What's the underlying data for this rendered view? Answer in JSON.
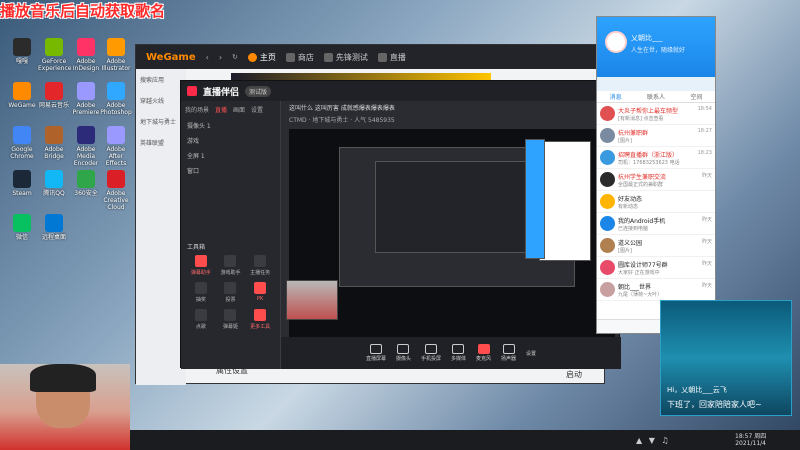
{
  "overlay": {
    "title": "播放音乐后自动获取歌名"
  },
  "desktop": {
    "icons": [
      {
        "label": "嘎嘎",
        "color": "#2b2b2b"
      },
      {
        "label": "GeForce Experience",
        "color": "#76b900"
      },
      {
        "label": "Adobe InDesign",
        "color": "#ff3366"
      },
      {
        "label": "Adobe Illustrator",
        "color": "#ff9a00"
      },
      {
        "label": "WeGame",
        "color": "#ff8a00"
      },
      {
        "label": "网易云音乐",
        "color": "#e3262a"
      },
      {
        "label": "Adobe Premiere",
        "color": "#9999ff"
      },
      {
        "label": "Adobe Photoshop",
        "color": "#31a8ff"
      },
      {
        "label": "Google Chrome",
        "color": "#4285f4"
      },
      {
        "label": "Adobe Bridge",
        "color": "#b0622b"
      },
      {
        "label": "Adobe Media Encoder",
        "color": "#2b2b7a"
      },
      {
        "label": "Adobe After Effects",
        "color": "#9999ff"
      },
      {
        "label": "Steam",
        "color": "#1b2838"
      },
      {
        "label": "腾讯QQ",
        "color": "#12b7f5"
      },
      {
        "label": "360安全",
        "color": "#2fa64a"
      },
      {
        "label": "Adobe Creative Cloud",
        "color": "#da1f26"
      },
      {
        "label": "微信",
        "color": "#07c160"
      },
      {
        "label": "远程桌面",
        "color": "#0078d4"
      }
    ]
  },
  "wegame": {
    "logo": "WeGame",
    "tabs": [
      "主页",
      "商店",
      "先锋测试",
      "直播"
    ],
    "side_items": [
      "搜索应用",
      "穿越火线",
      "地下城与勇士",
      "英雄联盟"
    ],
    "bottom_left": "属性设置",
    "bottom_right": "启动"
  },
  "live": {
    "logo": "直播伴侣",
    "version": "测试版",
    "left_tabs": [
      "我的场景",
      "直播",
      "画面",
      "设置"
    ],
    "scenes": [
      "摄像头 1",
      "游戏",
      "全屏 1",
      "窗口"
    ],
    "tools_title": "工具箱",
    "tools": [
      {
        "label": "弹幕助手",
        "red": true
      },
      {
        "label": "游戏助手",
        "red": false
      },
      {
        "label": "主播任务",
        "red": false
      },
      {
        "label": "抽奖",
        "red": false
      },
      {
        "label": "投票",
        "red": false
      },
      {
        "label": "PK",
        "red": true
      },
      {
        "label": "点歌",
        "red": false
      },
      {
        "label": "弹幕姬",
        "red": false
      },
      {
        "label": "更多工具",
        "red": true
      }
    ],
    "status_line": "这叫什么 这叫厉害 成就感爆表爆表爆表",
    "sub_line": "CTMD · 地下城与勇士  ·  人气 5485935",
    "bottom_bar": [
      {
        "label": "直播屏幕",
        "red": false
      },
      {
        "label": "摄像头",
        "red": false
      },
      {
        "label": "手机投屏",
        "red": false
      },
      {
        "label": "多媒体",
        "red": false
      },
      {
        "label": "麦克风",
        "red": true
      },
      {
        "label": "扬声器",
        "red": false
      }
    ],
    "settings_label": "设置"
  },
  "qq": {
    "name": "乂朝比___",
    "signature": "人生在世，随缘就好",
    "tabs": [
      "消息",
      "联系人",
      "空间"
    ],
    "items": [
      {
        "name": "大炎子帮你上最车频型",
        "msg": "[有新消息] 点击查看",
        "time": "18:54",
        "color": "#e05050",
        "red": true
      },
      {
        "name": "杭州兼职群",
        "msg": "[图片]",
        "time": "18:27",
        "color": "#7a8aa0",
        "red": true
      },
      {
        "name": "招聘直播群（浙江版）",
        "msg": "司机：17683253623 电话",
        "time": "18:23",
        "color": "#3a9ae0",
        "red": true
      },
      {
        "name": "杭州学生兼职交流",
        "msg": "全国最正式的兼职群",
        "time": "昨天",
        "color": "#2b2b2b",
        "red": true
      },
      {
        "name": "好友动态",
        "msg": "有新动态",
        "time": "",
        "color": "#ffb400",
        "red": false
      },
      {
        "name": "我的Android手机",
        "msg": "已连接到电脑",
        "time": "昨天",
        "color": "#1a86e8",
        "red": false
      },
      {
        "name": "道义公园",
        "msg": "[图片]",
        "time": "昨天",
        "color": "#b08050",
        "red": false
      },
      {
        "name": "圆库设计师77号群",
        "msg": "大家好 正在游戏中",
        "time": "昨天",
        "color": "#e84a6a",
        "red": false
      },
      {
        "name": "朝比___世界",
        "msg": "九尾（薄荷~大叶）",
        "time": "昨天",
        "color": "#c8a0a0",
        "red": false
      }
    ]
  },
  "notification": {
    "greeting": "Hi，乂朝比___云飞",
    "message": "下班了，回家陪陪家人吧~"
  },
  "taskbar": {
    "time": "18:57 周四",
    "date": "2021/11/4"
  }
}
